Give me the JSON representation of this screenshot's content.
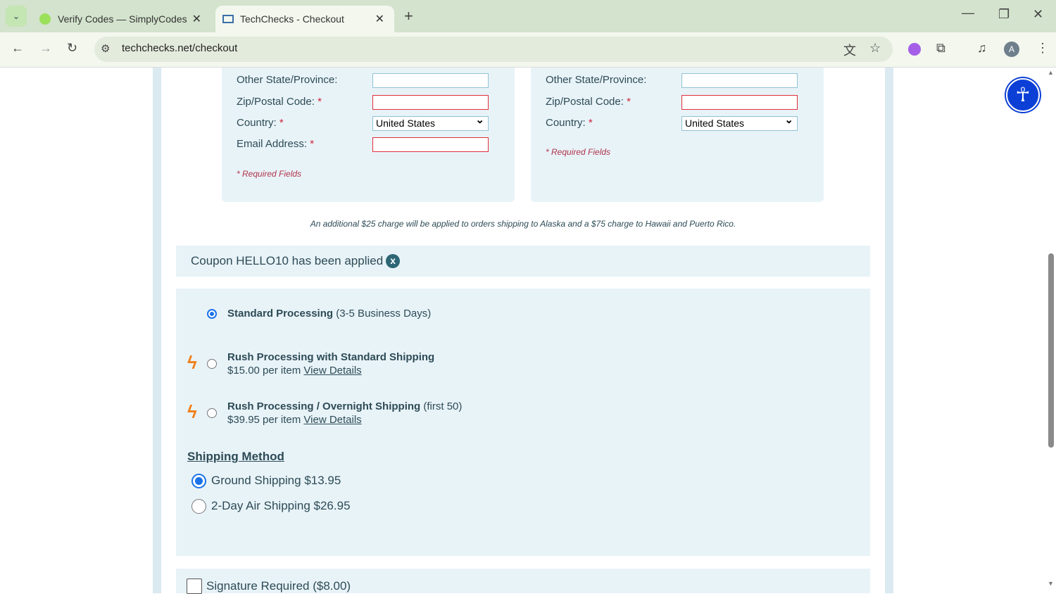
{
  "browser": {
    "tabs": [
      {
        "title": "Verify Codes — SimplyCodes"
      },
      {
        "title": "TechChecks - Checkout"
      }
    ],
    "url": "techchecks.net/checkout",
    "profile_initial": "A"
  },
  "billing": {
    "other_state_label": "Other State/Province:",
    "zip_label": "Zip/Postal Code:",
    "country_label": "Country:",
    "country_value": "United States",
    "email_label": "Email Address:",
    "required_note": "* Required Fields"
  },
  "shipping": {
    "other_state_label": "Other State/Province:",
    "zip_label": "Zip/Postal Code:",
    "country_label": "Country:",
    "country_value": "United States",
    "required_note": "* Required Fields"
  },
  "req_star": "*",
  "notice": "An additional $25 charge will be applied to orders shipping to Alaska and a $75 charge to Hawaii and Puerto Rico.",
  "coupon": {
    "text": "Coupon HELLO10 has been applied",
    "remove": "x"
  },
  "processing": [
    {
      "name": "Standard Processing",
      "extra": "(3-5 Business Days)",
      "selected": true
    },
    {
      "name": "Rush Processing with Standard Shipping",
      "extra": "",
      "price": "$15.00 per item",
      "link": "View Details",
      "selected": false
    },
    {
      "name": "Rush Processing / Overnight Shipping",
      "extra": "(first 50)",
      "price": "$39.95 per item",
      "link": "View Details",
      "selected": false
    }
  ],
  "shipping_method": {
    "title": "Shipping Method",
    "options": [
      {
        "label": "Ground Shipping $13.95",
        "selected": true
      },
      {
        "label": "2-Day Air Shipping $26.95",
        "selected": false
      }
    ]
  },
  "signature": {
    "label": "Signature Required ($8.00)",
    "checked": false
  }
}
